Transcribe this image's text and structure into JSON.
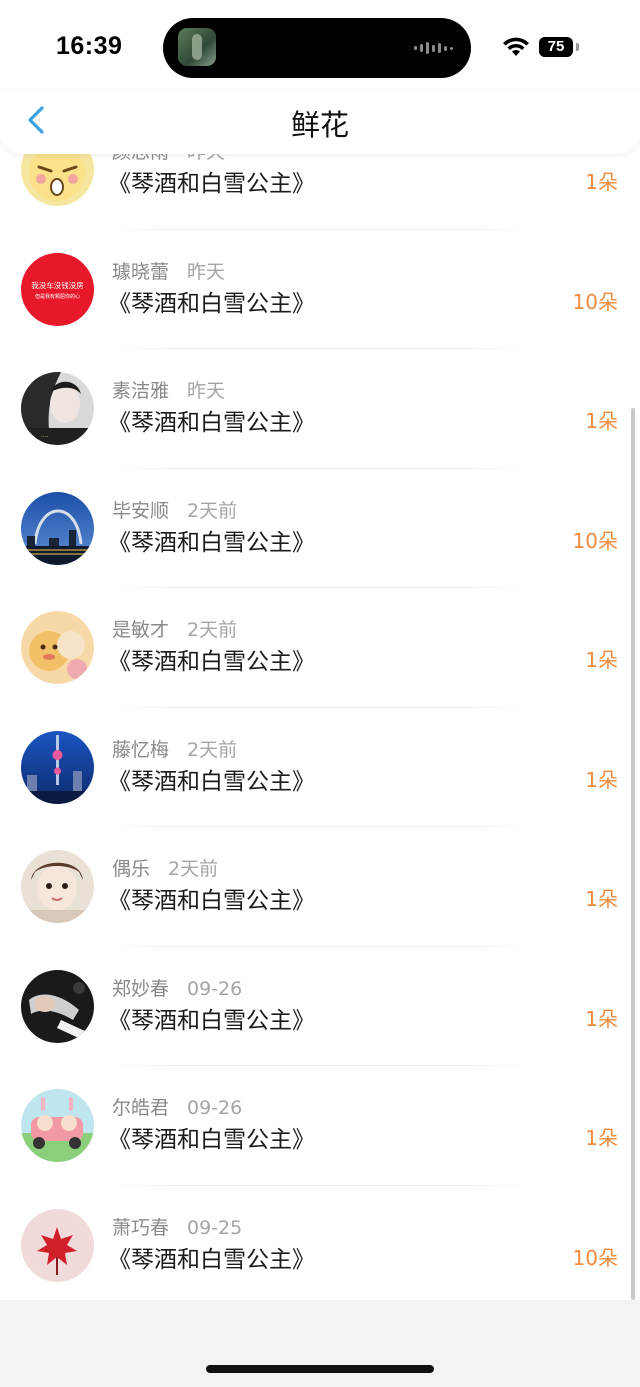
{
  "status_bar": {
    "time": "16:39",
    "battery": "75"
  },
  "nav": {
    "title": "鲜花"
  },
  "colors": {
    "accent": "#3aa0e6",
    "quantity": "#f08a3c"
  },
  "rows": [
    {
      "name": "颜思雨",
      "when": "昨天",
      "book": "《琴酒和白雪公主》",
      "quantity": "1朵"
    },
    {
      "name": "璩晓蕾",
      "when": "昨天",
      "book": "《琴酒和白雪公主》",
      "quantity": "10朵"
    },
    {
      "name": "素洁雅",
      "when": "昨天",
      "book": "《琴酒和白雪公主》",
      "quantity": "1朵"
    },
    {
      "name": "毕安顺",
      "when": "2天前",
      "book": "《琴酒和白雪公主》",
      "quantity": "10朵"
    },
    {
      "name": "是敏才",
      "when": "2天前",
      "book": "《琴酒和白雪公主》",
      "quantity": "1朵"
    },
    {
      "name": "藤忆梅",
      "when": "2天前",
      "book": "《琴酒和白雪公主》",
      "quantity": "1朵"
    },
    {
      "name": "偶乐",
      "when": "2天前",
      "book": "《琴酒和白雪公主》",
      "quantity": "1朵"
    },
    {
      "name": "郑妙春",
      "when": "09-26",
      "book": "《琴酒和白雪公主》",
      "quantity": "1朵"
    },
    {
      "name": "尔皓君",
      "when": "09-26",
      "book": "《琴酒和白雪公主》",
      "quantity": "1朵"
    },
    {
      "name": "萧巧春",
      "when": "09-25",
      "book": "《琴酒和白雪公主》",
      "quantity": "10朵"
    }
  ],
  "avatar_texts": {
    "row2_line1": "我没车没钱没房",
    "row2_line2": "但是我有颗屈你的心"
  }
}
